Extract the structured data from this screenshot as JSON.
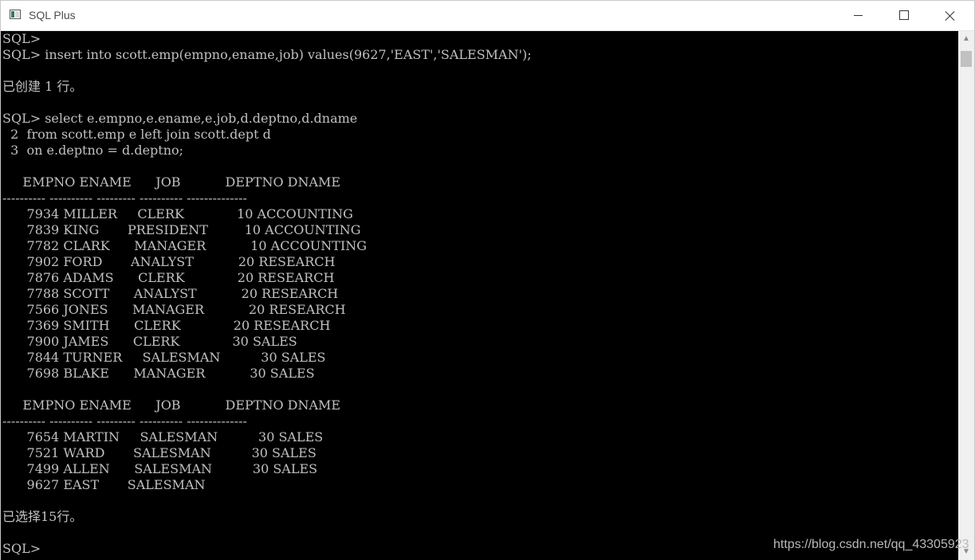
{
  "window": {
    "title": "SQL Plus",
    "icons": {
      "app": "sqlplus-app-icon",
      "minimize": "minimize-icon",
      "maximize": "maximize-icon",
      "close": "close-icon"
    }
  },
  "console": {
    "lines": [
      "SQL>",
      "SQL> insert into scott.emp(empno,ename,job) values(9627,'EAST','SALESMAN');",
      "",
      "已创建 1 行。",
      "",
      "SQL> select e.empno,e.ename,e.job,d.deptno,d.dname",
      "  2  from scott.emp e left join scott.dept d",
      "  3  on e.deptno = d.deptno;",
      "",
      "     EMPNO ENAME      JOB           DEPTNO DNAME",
      "---------- ---------- --------- ---------- --------------",
      "      7934 MILLER     CLERK             10 ACCOUNTING",
      "      7839 KING       PRESIDENT         10 ACCOUNTING",
      "      7782 CLARK      MANAGER           10 ACCOUNTING",
      "      7902 FORD       ANALYST           20 RESEARCH",
      "      7876 ADAMS      CLERK             20 RESEARCH",
      "      7788 SCOTT      ANALYST           20 RESEARCH",
      "      7566 JONES      MANAGER           20 RESEARCH",
      "      7369 SMITH      CLERK             20 RESEARCH",
      "      7900 JAMES      CLERK             30 SALES",
      "      7844 TURNER     SALESMAN          30 SALES",
      "      7698 BLAKE      MANAGER           30 SALES",
      "",
      "     EMPNO ENAME      JOB           DEPTNO DNAME",
      "---------- ---------- --------- ---------- --------------",
      "      7654 MARTIN     SALESMAN          30 SALES",
      "      7521 WARD       SALESMAN          30 SALES",
      "      7499 ALLEN      SALESMAN          30 SALES",
      "      9627 EAST       SALESMAN",
      "",
      "已选择15行。",
      "",
      "SQL>"
    ]
  },
  "watermark": "https://blog.csdn.net/qq_43305923",
  "colors": {
    "console_bg": "#000000",
    "console_text": "#c0c0c0",
    "titlebar_bg": "#ffffff"
  }
}
